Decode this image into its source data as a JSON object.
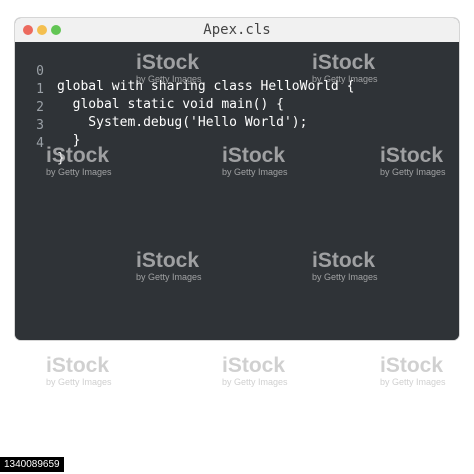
{
  "window": {
    "title": "Apex.cls"
  },
  "editor": {
    "line_numbers": [
      "0",
      "1",
      "2",
      "3",
      "4"
    ],
    "lines": [
      "global with sharing class HelloWorld {",
      "  global static void main() {",
      "    System.debug('Hello World');",
      "  }",
      "}"
    ]
  },
  "watermark": {
    "brand": "iStock",
    "credit": "by Getty Images"
  },
  "footer": {
    "id": "1340089659"
  },
  "colors": {
    "editor_bg": "#2f3337",
    "titlebar_bg": "#f1f1f1",
    "close": "#ec6a5e",
    "minimize": "#f4bf4f",
    "maximize": "#62c554"
  }
}
